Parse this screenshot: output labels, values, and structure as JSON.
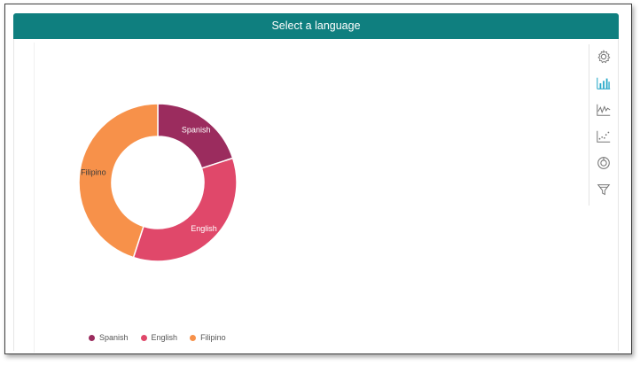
{
  "header": {
    "title": "Select a language"
  },
  "toolbar": {
    "items": [
      {
        "icon": "gear-icon"
      },
      {
        "icon": "bar-chart-icon",
        "active": true
      },
      {
        "icon": "line-chart-icon"
      },
      {
        "icon": "scatter-chart-icon"
      },
      {
        "icon": "donut-chart-icon"
      },
      {
        "icon": "funnel-icon"
      }
    ],
    "active_color": "#2aa9c9",
    "icon_color": "#777777"
  },
  "chart_data": {
    "type": "pie",
    "variant": "donut",
    "categories": [
      "Spanish",
      "English",
      "Filipino"
    ],
    "values": [
      20,
      35,
      45
    ],
    "colors": [
      "#9b2c5e",
      "#e0486a",
      "#f7914a"
    ],
    "legend": {
      "position": "bottom-left",
      "entries": [
        "Spanish",
        "English",
        "Filipino"
      ]
    }
  },
  "legend": {
    "items": [
      {
        "label": "Spanish",
        "color": "#9b2c5e"
      },
      {
        "label": "English",
        "color": "#e0486a"
      },
      {
        "label": "Filipino",
        "color": "#f7914a"
      }
    ]
  }
}
